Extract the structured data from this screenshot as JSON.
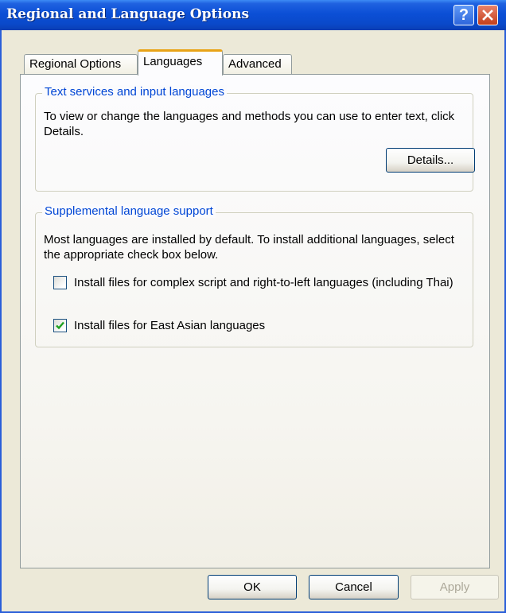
{
  "window": {
    "title": "Regional and Language Options"
  },
  "titlebar": {
    "help_label": "?"
  },
  "tabs": [
    {
      "label": "Regional Options"
    },
    {
      "label": "Languages",
      "selected": true
    },
    {
      "label": "Advanced"
    }
  ],
  "text_services": {
    "legend": "Text services and input languages",
    "description": "To view or change the languages and methods you can use to enter text, click Details.",
    "details_button": "Details..."
  },
  "supplemental": {
    "legend": "Supplemental language support",
    "description": "Most languages are installed by default. To install additional languages, select the appropriate check box below.",
    "options": [
      {
        "label": "Install files for complex script and right-to-left languages (including Thai)",
        "checked": false
      },
      {
        "label": "Install files for East Asian languages",
        "checked": true
      }
    ]
  },
  "footer": {
    "ok_label": "OK",
    "cancel_label": "Cancel",
    "apply_label": "Apply",
    "apply_enabled": false
  },
  "colors": {
    "title_bar": "#0b4fd6",
    "group_label": "#0046d5",
    "active_tab_accent": "#e8a317",
    "checkmark": "#21a121"
  }
}
